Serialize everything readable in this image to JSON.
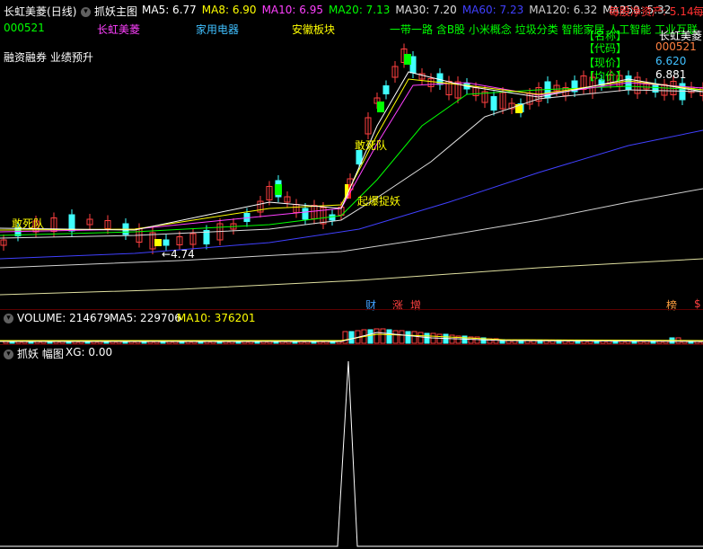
{
  "header": {
    "stock_title": "长虹美菱",
    "period": "(日线)",
    "indicator_name": "抓妖主图",
    "ma": [
      {
        "label": "MA5: 6.77",
        "color": "#ffffff"
      },
      {
        "label": "MA8: 6.90",
        "color": "#ffff00"
      },
      {
        "label": "MA10: 6.95",
        "color": "#ff40ff"
      },
      {
        "label": "MA20: 7.13",
        "color": "#00ff00"
      },
      {
        "label": "MA30: 7.20",
        "color": "#e0e0e0"
      },
      {
        "label": "MA60: 7.23",
        "color": "#4040ff"
      },
      {
        "label": "MA120: 6.32",
        "color": "#d0d0d0"
      },
      {
        "label": "MA250: 5.32",
        "color": "#e0e0e0"
      }
    ],
    "net_asset": "每股净资产: 5.14",
    "net_asset_cut": "每"
  },
  "row2": {
    "code": "000521",
    "name": "长虹美菱",
    "industry": "家用电器",
    "sector": "安徽板块",
    "concepts": "一带一路 含B股 小米概念 垃圾分类 智能家居 人工智能 工业互联"
  },
  "row3": {
    "margin": "融资融券 业绩预升"
  },
  "info_box": {
    "name_label": "【名称】",
    "name_value": "长虹美菱",
    "code_label": "【代码】",
    "code_value": "000521",
    "price_label": "【现价】",
    "price_value": "6.620",
    "avg_label": "【均价】",
    "avg_value": "6.881"
  },
  "annotations": {
    "dare_die_1": "敢死队",
    "dare_die_2": "敢死队",
    "launch": "起爆捉妖",
    "low_price": "4.74",
    "event_cai": "财",
    "event_zhang": "涨",
    "event_zeng": "增",
    "event_bang": "榜",
    "event_dollar": "$"
  },
  "volume_panel": {
    "title": "VOLUME: 214679",
    "ma5": "MA5: 229706",
    "ma10": "MA10: 376201"
  },
  "bottom_panel": {
    "title": "抓妖 幅图",
    "xg": "XG: 0.00"
  }
}
